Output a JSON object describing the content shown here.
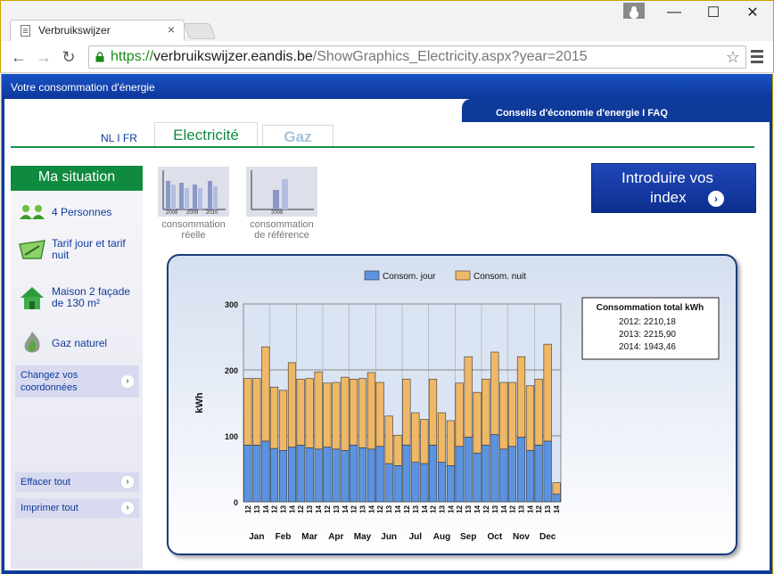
{
  "browser": {
    "tab_title": "Verbruikswijzer",
    "tab_close": "×",
    "url_scheme": "https://",
    "url_host": "verbruikswijzer.eandis.be",
    "url_path": "/ShowGraphics_Electricity.aspx?year=2015",
    "back": "←",
    "forward": "→",
    "reload": "↻",
    "star": "☆",
    "minimize": "—",
    "maximize": "☐",
    "close": "✕"
  },
  "header": {
    "banner": "Votre consommation d'énergie",
    "right_links": "Conseils d'économie d'energie I FAQ",
    "lang": "NL I FR",
    "tab_electricity": "Electricité",
    "tab_gas": "Gaz"
  },
  "sidebar": {
    "title": "Ma situation",
    "items": [
      {
        "label": "4 Personnes",
        "icon": "people-icon"
      },
      {
        "label": "Tarif jour et tarif nuit",
        "icon": "meter-gauge-icon"
      },
      {
        "label": "Maison 2 façade de 130 m²",
        "icon": "house-icon"
      },
      {
        "label": "Gaz naturel",
        "icon": "flame-icon"
      }
    ],
    "change_coords": "Changez vos coordonnées",
    "clear_all": "Effacer tout",
    "print_all": "Imprimer tout",
    "go_glyph": "›"
  },
  "views": {
    "real": {
      "caption_1": "consommation",
      "caption_2": "réelle",
      "years": [
        "2008",
        "2009",
        "2010"
      ]
    },
    "reference": {
      "caption_1": "consommation",
      "caption_2": "de référence",
      "year": "2008"
    }
  },
  "intro_button": {
    "line1": "Introduire vos",
    "line2": "index",
    "go": "›"
  },
  "colors": {
    "day": "#5b93e0",
    "night": "#f0b866",
    "brand_green": "#0f8a3e",
    "brand_blue": "#0e3a9a"
  },
  "chart_data": {
    "type": "bar",
    "stacked": true,
    "ylabel": "kWh",
    "ylim": [
      0,
      300
    ],
    "yticks": [
      0,
      100,
      200,
      300
    ],
    "months": [
      "Jan",
      "Feb",
      "Mar",
      "Apr",
      "May",
      "Jun",
      "Jul",
      "Aug",
      "Sep",
      "Oct",
      "Nov",
      "Dec"
    ],
    "years": [
      "12",
      "13",
      "14"
    ],
    "legend": [
      "Consom. jour",
      "Consom. nuit"
    ],
    "series": [
      {
        "name": "Consom. jour",
        "values": [
          [
            86,
            86,
            92
          ],
          [
            81,
            78,
            83
          ],
          [
            86,
            82,
            80
          ],
          [
            83,
            80,
            78
          ],
          [
            86,
            82,
            80
          ],
          [
            84,
            58,
            55
          ],
          [
            86,
            60,
            58
          ],
          [
            86,
            60,
            55
          ],
          [
            84,
            98,
            74
          ],
          [
            86,
            102,
            80
          ],
          [
            84,
            98,
            78
          ],
          [
            86,
            92,
            12
          ]
        ]
      },
      {
        "name": "Consom. nuit",
        "values": [
          [
            101,
            101,
            143
          ],
          [
            93,
            91,
            128
          ],
          [
            100,
            105,
            117
          ],
          [
            97,
            101,
            111
          ],
          [
            100,
            105,
            116
          ],
          [
            97,
            72,
            46
          ],
          [
            100,
            75,
            67
          ],
          [
            100,
            75,
            68
          ],
          [
            96,
            122,
            92
          ],
          [
            100,
            125,
            101
          ],
          [
            97,
            122,
            98
          ],
          [
            100,
            147,
            17
          ]
        ]
      }
    ],
    "totals_box": {
      "title": "Consommation total kWh",
      "lines": [
        "2012: 2210,18",
        "2013: 2215,90",
        "2014: 1943,46"
      ]
    }
  }
}
